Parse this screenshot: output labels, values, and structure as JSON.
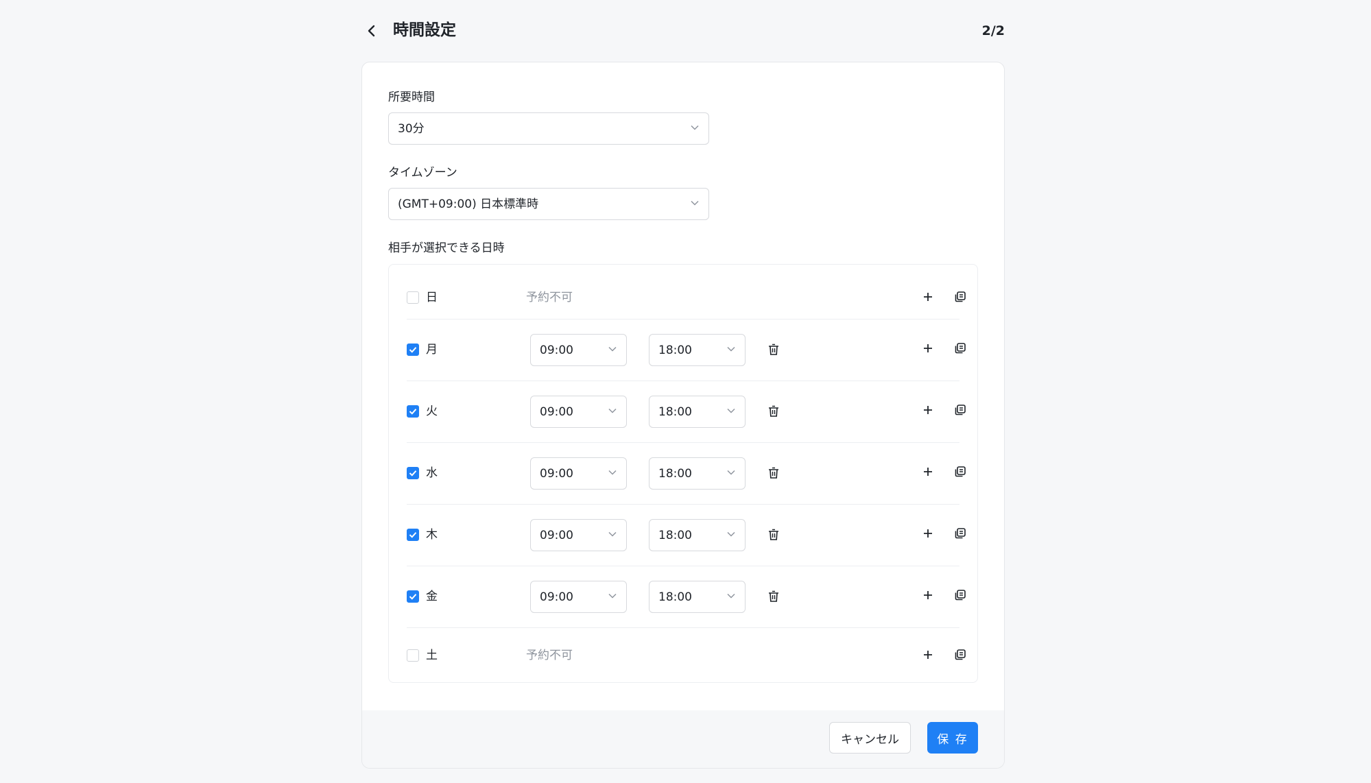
{
  "header": {
    "title": "時間設定",
    "step": "2/2"
  },
  "duration": {
    "label": "所要時間",
    "value": "30分"
  },
  "timezone": {
    "label": "タイムゾーン",
    "value": "(GMT+09:00) 日本標準時"
  },
  "availability": {
    "label": "相手が選択できる日時",
    "days": [
      {
        "name": "日",
        "checked": false,
        "unavailable_text": "予約不可"
      },
      {
        "name": "月",
        "checked": true,
        "start": "09:00",
        "end": "18:00"
      },
      {
        "name": "火",
        "checked": true,
        "start": "09:00",
        "end": "18:00"
      },
      {
        "name": "水",
        "checked": true,
        "start": "09:00",
        "end": "18:00"
      },
      {
        "name": "木",
        "checked": true,
        "start": "09:00",
        "end": "18:00"
      },
      {
        "name": "金",
        "checked": true,
        "start": "09:00",
        "end": "18:00"
      },
      {
        "name": "土",
        "checked": false,
        "unavailable_text": "予約不可"
      }
    ]
  },
  "footer": {
    "cancel_label": "キャンセル",
    "save_label": "保 存"
  },
  "colors": {
    "accent": "#1f80f5",
    "muted_text": "#8f959e",
    "border": "#d7d9dd"
  },
  "icons": {
    "back": "chevron-left-icon",
    "dropdown": "chevron-down-icon",
    "delete": "trash-icon",
    "add": "plus-icon",
    "copy": "copy-icon",
    "check": "check-icon"
  }
}
